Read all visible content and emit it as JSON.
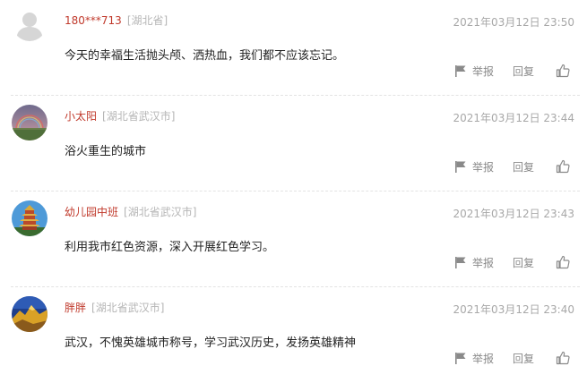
{
  "comments": [
    {
      "username": "180***713",
      "location": "[湖北省]",
      "time": "2021年03月12日 23:50",
      "content": "今天的幸福生活抛头颅、洒热血，我们都不应该忘记。",
      "avatar": "default-avatar"
    },
    {
      "username": "小太阳",
      "location": "[湖北省武汉市]",
      "time": "2021年03月12日 23:44",
      "content": "浴火重生的城市",
      "avatar": "rainbow-landscape-avatar"
    },
    {
      "username": "幼儿园中班",
      "location": "[湖北省武汉市]",
      "time": "2021年03月12日 23:43",
      "content": "利用我市红色资源，深入开展红色学习。",
      "avatar": "yellow-crane-tower-avatar"
    },
    {
      "username": "胖胖",
      "location": "[湖北省武汉市]",
      "time": "2021年03月12日 23:40",
      "content": "武汉，不愧英雄城市称号，学习武汉历史，发扬英雄精神",
      "avatar": "golden-mountain-avatar"
    }
  ],
  "actions": {
    "report_label": "举报",
    "reply_label": "回复"
  },
  "colors": {
    "username": "#c0392b",
    "location": "#b5b5b5",
    "timestamp": "#a8a8a8",
    "action": "#8a8a8a",
    "divider": "#e3e3e3"
  }
}
